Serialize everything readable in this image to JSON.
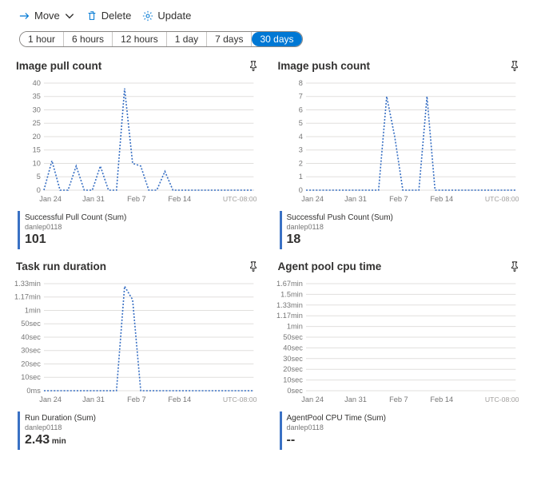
{
  "toolbar": {
    "move_label": "Move",
    "delete_label": "Delete",
    "update_label": "Update"
  },
  "time_ranges": [
    "1 hour",
    "6 hours",
    "12 hours",
    "1 day",
    "7 days",
    "30 days"
  ],
  "time_selected": "30 days",
  "tz_label": "UTC-08:00",
  "x_ticks": [
    "Jan 24",
    "Jan 31",
    "Feb 7",
    "Feb 14"
  ],
  "charts": [
    {
      "title": "Image pull count",
      "legend": {
        "name": "Successful Pull Count (Sum)",
        "resource": "danlep0118",
        "value": "101",
        "unit": ""
      },
      "y_ticks": [
        "0",
        "5",
        "10",
        "15",
        "20",
        "25",
        "30",
        "35",
        "40"
      ]
    },
    {
      "title": "Image push count",
      "legend": {
        "name": "Successful Push Count (Sum)",
        "resource": "danlep0118",
        "value": "18",
        "unit": ""
      },
      "y_ticks": [
        "0",
        "1",
        "2",
        "3",
        "4",
        "5",
        "6",
        "7",
        "8"
      ]
    },
    {
      "title": "Task run duration",
      "legend": {
        "name": "Run Duration (Sum)",
        "resource": "danlep0118",
        "value": "2.43",
        "unit": "min"
      },
      "y_ticks": [
        "0ms",
        "10sec",
        "20sec",
        "30sec",
        "40sec",
        "50sec",
        "1min",
        "1.17min",
        "1.33min"
      ]
    },
    {
      "title": "Agent pool cpu time",
      "legend": {
        "name": "AgentPool CPU Time (Sum)",
        "resource": "danlep0118",
        "value": "--",
        "unit": ""
      },
      "y_ticks": [
        "0sec",
        "10sec",
        "20sec",
        "30sec",
        "40sec",
        "50sec",
        "1min",
        "1.17min",
        "1.33min",
        "1.5min",
        "1.67min"
      ]
    }
  ],
  "chart_data": [
    {
      "type": "line",
      "title": "Image pull count",
      "xlabel": "",
      "ylabel": "",
      "ylim": [
        0,
        40
      ],
      "categories": [
        "Jan 24",
        "Jan 25",
        "Jan 26",
        "Jan 27",
        "Jan 28",
        "Jan 29",
        "Jan 30",
        "Jan 31",
        "Feb 1",
        "Feb 2",
        "Feb 3",
        "Feb 4",
        "Feb 5",
        "Feb 6",
        "Feb 7",
        "Feb 8",
        "Feb 9",
        "Feb 10",
        "Feb 11",
        "Feb 12",
        "Feb 13",
        "Feb 14",
        "Feb 15",
        "Feb 16",
        "Feb 17",
        "Feb 18",
        "Feb 19"
      ],
      "values": [
        0,
        11,
        0,
        0,
        9,
        0,
        0,
        9,
        0,
        0,
        38,
        10,
        9,
        0,
        0,
        7,
        0,
        0,
        0,
        0,
        0,
        0,
        0,
        0,
        0,
        0,
        0
      ],
      "series_name": "Successful Pull Count (Sum)",
      "total": 101
    },
    {
      "type": "line",
      "title": "Image push count",
      "xlabel": "",
      "ylabel": "",
      "ylim": [
        0,
        8
      ],
      "categories": [
        "Jan 24",
        "Jan 25",
        "Jan 26",
        "Jan 27",
        "Jan 28",
        "Jan 29",
        "Jan 30",
        "Jan 31",
        "Feb 1",
        "Feb 2",
        "Feb 3",
        "Feb 4",
        "Feb 5",
        "Feb 6",
        "Feb 7",
        "Feb 8",
        "Feb 9",
        "Feb 10",
        "Feb 11",
        "Feb 12",
        "Feb 13",
        "Feb 14",
        "Feb 15",
        "Feb 16",
        "Feb 17",
        "Feb 18",
        "Feb 19"
      ],
      "values": [
        0,
        0,
        0,
        0,
        0,
        0,
        0,
        0,
        0,
        0,
        7,
        4,
        0,
        0,
        0,
        7,
        0,
        0,
        0,
        0,
        0,
        0,
        0,
        0,
        0,
        0,
        0
      ],
      "series_name": "Successful Push Count (Sum)",
      "total": 18
    },
    {
      "type": "line",
      "title": "Task run duration",
      "xlabel": "",
      "ylabel": "",
      "ylim_sec": [
        0,
        80
      ],
      "categories": [
        "Jan 24",
        "Jan 25",
        "Jan 26",
        "Jan 27",
        "Jan 28",
        "Jan 29",
        "Jan 30",
        "Jan 31",
        "Feb 1",
        "Feb 2",
        "Feb 3",
        "Feb 4",
        "Feb 5",
        "Feb 6",
        "Feb 7",
        "Feb 8",
        "Feb 9",
        "Feb 10",
        "Feb 11",
        "Feb 12",
        "Feb 13",
        "Feb 14",
        "Feb 15",
        "Feb 16",
        "Feb 17",
        "Feb 18",
        "Feb 19"
      ],
      "values_sec": [
        0,
        0,
        0,
        0,
        0,
        0,
        0,
        0,
        0,
        0,
        78,
        68,
        0,
        0,
        0,
        0,
        0,
        0,
        0,
        0,
        0,
        0,
        0,
        0,
        0,
        0,
        0
      ],
      "series_name": "Run Duration (Sum)",
      "total_min": 2.43
    },
    {
      "type": "line",
      "title": "Agent pool cpu time",
      "xlabel": "",
      "ylabel": "",
      "ylim_sec": [
        0,
        100
      ],
      "categories": [
        "Jan 24",
        "Jan 25",
        "Jan 26",
        "Jan 27",
        "Jan 28",
        "Jan 29",
        "Jan 30",
        "Jan 31",
        "Feb 1",
        "Feb 2",
        "Feb 3",
        "Feb 4",
        "Feb 5",
        "Feb 6",
        "Feb 7",
        "Feb 8",
        "Feb 9",
        "Feb 10",
        "Feb 11",
        "Feb 12",
        "Feb 13",
        "Feb 14",
        "Feb 15",
        "Feb 16",
        "Feb 17",
        "Feb 18",
        "Feb 19"
      ],
      "values_sec": [],
      "series_name": "AgentPool CPU Time (Sum)",
      "total": null
    }
  ]
}
